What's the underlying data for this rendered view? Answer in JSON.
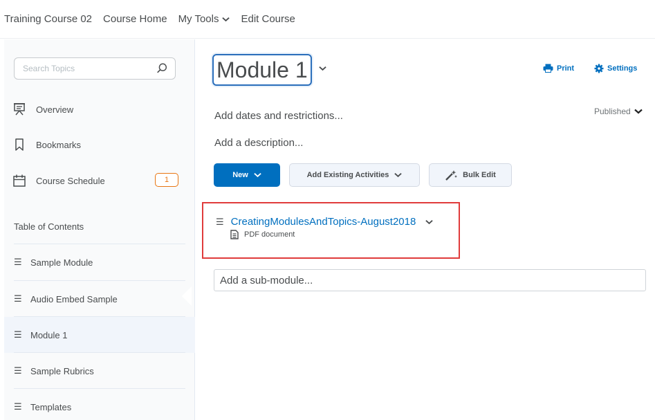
{
  "topnav": {
    "course_name": "Training Course 02",
    "course_home": "Course Home",
    "my_tools": "My Tools",
    "edit_course": "Edit Course"
  },
  "sidebar": {
    "search_placeholder": "Search Topics",
    "items": [
      {
        "label": "Overview",
        "icon": "presentation-icon"
      },
      {
        "label": "Bookmarks",
        "icon": "bookmark-icon"
      },
      {
        "label": "Course Schedule",
        "icon": "calendar-icon",
        "badge": "1"
      }
    ],
    "toc_label": "Table of Contents",
    "toc_items": [
      {
        "label": "Sample Module"
      },
      {
        "label": "Audio Embed Sample"
      },
      {
        "label": "Module 1",
        "active": true
      },
      {
        "label": "Sample Rubrics"
      },
      {
        "label": "Templates"
      }
    ]
  },
  "main": {
    "module_title": "Module 1",
    "print_label": "Print",
    "settings_label": "Settings",
    "dates_placeholder": "Add dates and restrictions...",
    "published_label": "Published",
    "description_placeholder": "Add a description...",
    "new_button": "New",
    "add_existing_button": "Add Existing Activities",
    "bulk_edit_button": "Bulk Edit",
    "topic": {
      "title": "CreatingModulesAndTopics-August2018",
      "type": "PDF document"
    },
    "submodule_placeholder": "Add a sub-module..."
  },
  "colors": {
    "link": "#006fbf",
    "primary_button": "#006fbf",
    "highlight_border": "#e03b3b",
    "badge": "#e87511"
  }
}
